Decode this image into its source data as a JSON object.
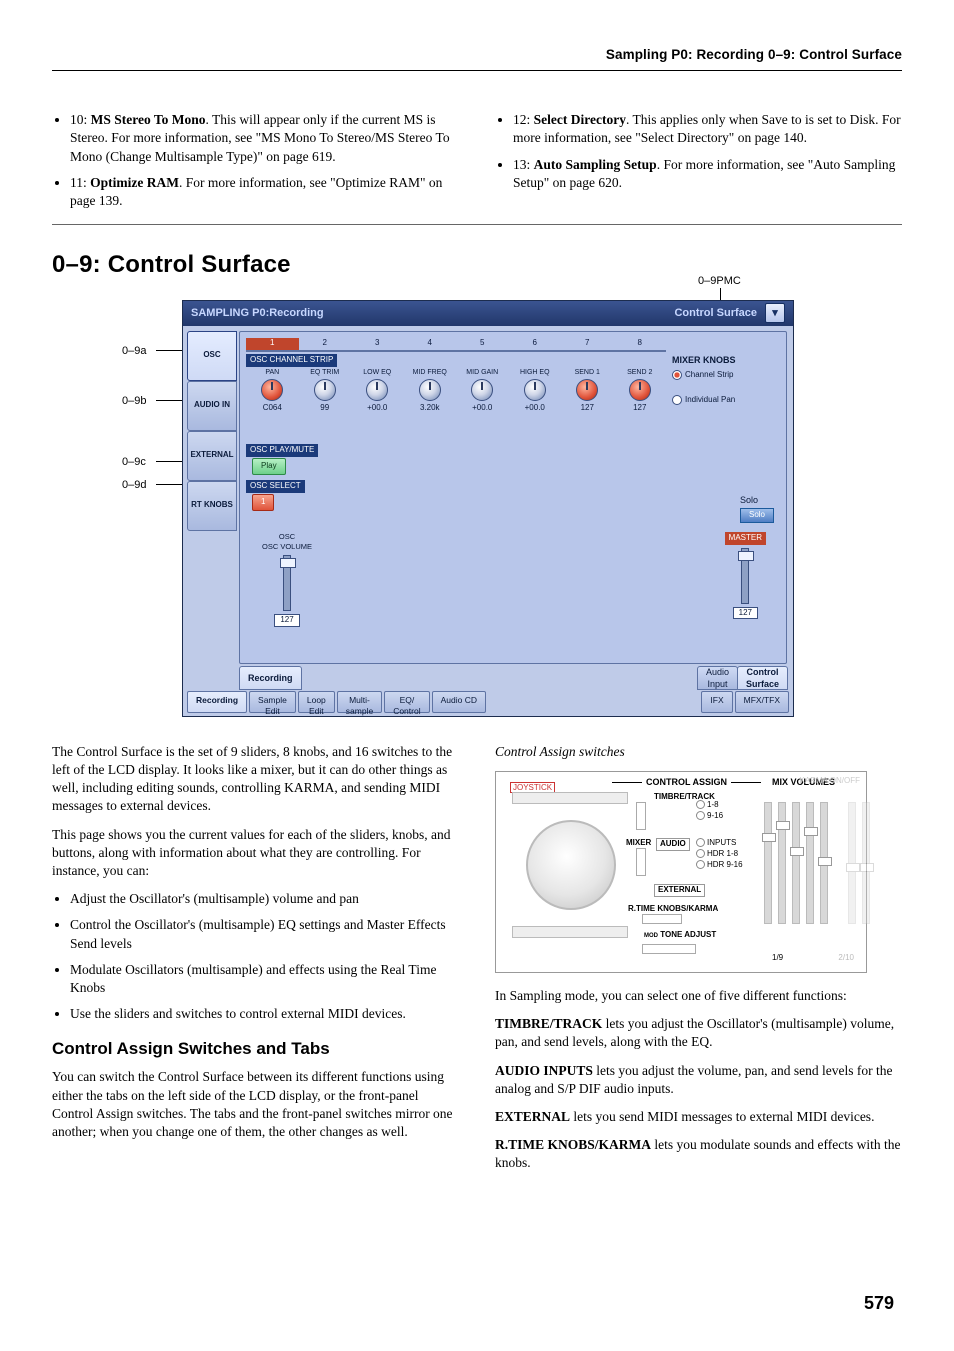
{
  "header": {
    "running": "Sampling P0: Recording   0–9: Control Surface"
  },
  "top": {
    "left": [
      {
        "num": "10",
        "bold": "MS Stereo To Mono",
        "rest": ". This will appear only if the current MS is Stereo. For more information, see \"MS Mono To Stereo/MS Stereo To Mono (Change Multisample Type)\" on page 619."
      },
      {
        "num": "11",
        "bold": "Optimize RAM",
        "rest": ". For more information, see \"Optimize RAM\" on page 139."
      }
    ],
    "right": [
      {
        "num": "12",
        "bold": "Select Directory",
        "rest": ". This applies only when Save to is set to Disk. For more information, see \"Select Directory\" on page 140."
      },
      {
        "num": "13",
        "bold": "Auto Sampling Setup",
        "rest": ". For more information, see \"Auto Sampling Setup\" on page 620."
      }
    ]
  },
  "section_title": "0–9: Control Surface",
  "markers": {
    "a": "0–9a",
    "b": "0–9b",
    "c": "0–9c",
    "d": "0–9d",
    "pmc": "0–9PMC"
  },
  "shot": {
    "title_left": "SAMPLING P0:Recording",
    "title_right": "Control Surface",
    "left_tabs": [
      "OSC",
      "AUDIO IN",
      "EXTERNAL",
      "RT KNOBS"
    ],
    "mixer_head_label": "OSC CHANNEL STRIP",
    "knob_cols": [
      {
        "label": "PAN",
        "val": "C064",
        "red": true
      },
      {
        "label": "EQ TRIM",
        "val": "99"
      },
      {
        "label": "LOW EQ",
        "val": "+00.0"
      },
      {
        "label": "MID FREQ",
        "val": "3.20k"
      },
      {
        "label": "MID GAIN",
        "val": "+00.0"
      },
      {
        "label": "HIGH EQ",
        "val": "+00.0"
      },
      {
        "label": "SEND 1",
        "val": "127",
        "red": true
      },
      {
        "label": "SEND 2",
        "val": "127",
        "red": true
      }
    ],
    "mixer_knobs_label": "MIXER KNOBS",
    "radio1": "Channel Strip",
    "radio2": "Individual Pan",
    "play_label_head": "OSC PLAY/MUTE",
    "play": "Play",
    "osc_select_head": "OSC SELECT",
    "osc_select": "1",
    "solo_title": "Solo",
    "solo_btn": "Solo",
    "osc_vol_head": "OSC\nOSC VOLUME",
    "osc_val": "127",
    "master_label": "MASTER",
    "master_val": "127",
    "mid_tabs": {
      "rec": "Recording",
      "ain": "Audio\nInput",
      "cs": "Control\nSurface"
    },
    "bot_tabs": [
      "Recording",
      "Sample\nEdit",
      "Loop\nEdit",
      "Multi-\nsample",
      "EQ/\nControl",
      "Audio CD",
      "IFX",
      "MFX/TFX"
    ]
  },
  "body": {
    "left": {
      "p1": "The Control Surface is the set of 9 sliders, 8 knobs, and 16 switches to the left of the LCD display. It looks like a mixer, but it can do other things as well, including editing sounds, controlling KARMA, and sending MIDI messages to external devices.",
      "p2": "This page shows you the current values for each of the sliders, knobs, and buttons, along with information about what they are controlling. For instance, you can:",
      "bullets": [
        "Adjust the Oscillator's (multisample) volume and pan",
        "Control the Oscillator's (multisample) EQ settings and Master Effects Send levels",
        "Modulate Oscillators (multisample) and effects using the Real Time Knobs",
        "Use the sliders and switches to control external MIDI devices."
      ],
      "h2": "Control Assign Switches and Tabs",
      "p3": "You can switch the Control Surface between its different functions using either the tabs on the left side of the LCD display, or the front-panel Control Assign switches. The tabs and the front-panel switches mirror one another; when you change one of them, the other changes as well."
    },
    "right": {
      "caption": "Control Assign switches",
      "p1": "In Sampling mode, you can select one of five different functions:",
      "tt_lead": "TIMBRE/TRACK",
      "tt_rest": " lets you adjust the Oscillator's (multisample) volume, pan, and send levels, along with the EQ.",
      "ai_lead": "AUDIO INPUTS",
      "ai_rest": " lets you adjust the volume, pan, and send levels for the analog and S/P DIF audio inputs.",
      "ex_lead": "EXTERNAL",
      "ex_rest": " lets you send MIDI messages to external MIDI devices.",
      "rt_lead": "R.TIME KNOBS/KARMA",
      "rt_rest": " lets you modulate sounds and effects with the knobs."
    },
    "ca_panel": {
      "joy": "JOYSTICK",
      "head": "CONTROL ASSIGN",
      "vols": "MIX VOLUMES",
      "karma": "KARMA  ON/OFF",
      "tt": "TIMBRE/TRACK",
      "leds": [
        "1-8",
        "9-16",
        "INPUTS",
        "HDR 1-8",
        "HDR 9-16"
      ],
      "mixer": "MIXER",
      "audio": "AUDIO",
      "ext": "EXTERNAL",
      "rtk": "R.TIME KNOBS/KARMA",
      "mod": "MOD",
      "tone": "TONE ADJUST",
      "s1": "1/9",
      "s2": "2/10"
    }
  },
  "page_number": "579"
}
